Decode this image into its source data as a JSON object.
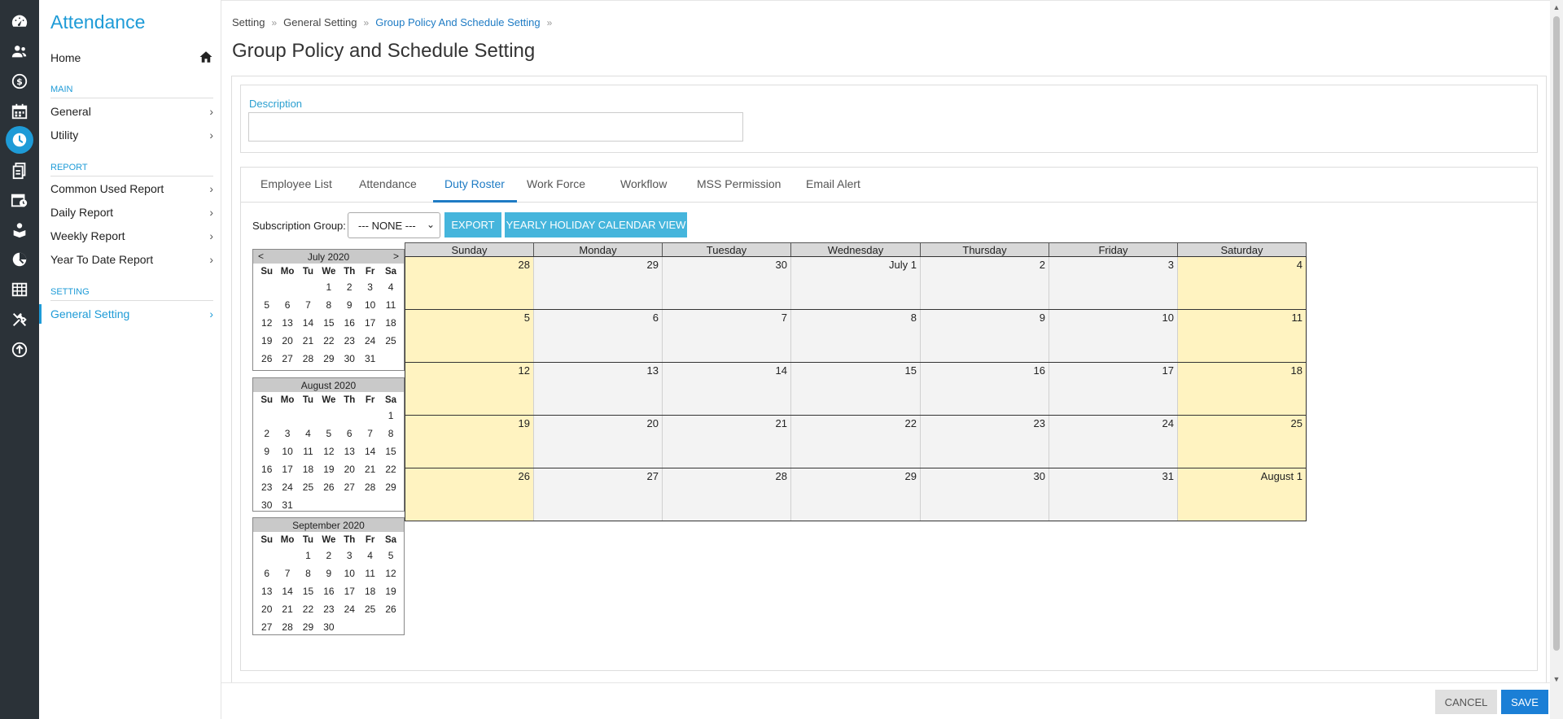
{
  "sidebar": {
    "app_title": "Attendance",
    "home_label": "Home",
    "sections": [
      {
        "title": "MAIN",
        "items": [
          "General",
          "Utility"
        ]
      },
      {
        "title": "REPORT",
        "items": [
          "Common Used Report",
          "Daily Report",
          "Weekly Report",
          "Year To Date Report"
        ]
      },
      {
        "title": "SETTING",
        "items": [
          "General Setting"
        ]
      }
    ],
    "active_item": "General Setting",
    "chevron": "›"
  },
  "breadcrumb": [
    "Setting",
    "General Setting",
    "Group Policy And Schedule Setting"
  ],
  "breadcrumb_sep": "»",
  "page_title": "Group Policy and Schedule Setting",
  "description": {
    "label": "Description",
    "value": ""
  },
  "tabs": [
    "Employee List",
    "Attendance",
    "Duty Roster",
    "Work Force",
    "Workflow",
    "MSS Permission",
    "Email Alert"
  ],
  "active_tab": "Duty Roster",
  "subscription": {
    "label": "Subscription Group:",
    "selected": "--- NONE ---"
  },
  "buttons": {
    "export": "EXPORT",
    "yearly": "YEARLY HOLIDAY CALENDAR VIEW",
    "cancel": "CANCEL",
    "save": "SAVE"
  },
  "mini_calendars": {
    "dow": [
      "Su",
      "Mo",
      "Tu",
      "We",
      "Th",
      "Fr",
      "Sa"
    ],
    "prev": "<",
    "next": ">",
    "months": [
      {
        "title": "July 2020",
        "weeks": [
          [
            "",
            "",
            "",
            "1",
            "2",
            "3",
            "4"
          ],
          [
            "5",
            "6",
            "7",
            "8",
            "9",
            "10",
            "11"
          ],
          [
            "12",
            "13",
            "14",
            "15",
            "16",
            "17",
            "18"
          ],
          [
            "19",
            "20",
            "21",
            "22",
            "23",
            "24",
            "25"
          ],
          [
            "26",
            "27",
            "28",
            "29",
            "30",
            "31",
            ""
          ]
        ]
      },
      {
        "title": "August 2020",
        "weeks": [
          [
            "",
            "",
            "",
            "",
            "",
            "",
            "1"
          ],
          [
            "2",
            "3",
            "4",
            "5",
            "6",
            "7",
            "8"
          ],
          [
            "9",
            "10",
            "11",
            "12",
            "13",
            "14",
            "15"
          ],
          [
            "16",
            "17",
            "18",
            "19",
            "20",
            "21",
            "22"
          ],
          [
            "23",
            "24",
            "25",
            "26",
            "27",
            "28",
            "29"
          ],
          [
            "30",
            "31",
            "",
            "",
            "",
            "",
            ""
          ]
        ]
      },
      {
        "title": "September 2020",
        "weeks": [
          [
            "",
            "",
            "1",
            "2",
            "3",
            "4",
            "5"
          ],
          [
            "6",
            "7",
            "8",
            "9",
            "10",
            "11",
            "12"
          ],
          [
            "13",
            "14",
            "15",
            "16",
            "17",
            "18",
            "19"
          ],
          [
            "20",
            "21",
            "22",
            "23",
            "24",
            "25",
            "26"
          ],
          [
            "27",
            "28",
            "29",
            "30",
            "",
            "",
            ""
          ]
        ]
      }
    ]
  },
  "calendar": {
    "days": [
      "Sunday",
      "Monday",
      "Tuesday",
      "Wednesday",
      "Thursday",
      "Friday",
      "Saturday"
    ],
    "weeks": [
      [
        "28",
        "29",
        "30",
        "July 1",
        "2",
        "3",
        "4"
      ],
      [
        "5",
        "6",
        "7",
        "8",
        "9",
        "10",
        "11"
      ],
      [
        "12",
        "13",
        "14",
        "15",
        "16",
        "17",
        "18"
      ],
      [
        "19",
        "20",
        "21",
        "22",
        "23",
        "24",
        "25"
      ],
      [
        "26",
        "27",
        "28",
        "29",
        "30",
        "31",
        "August 1"
      ]
    ]
  },
  "colors": {
    "accent": "#1e9bd7",
    "weekend": "#fff3c1",
    "weekday": "#f3f3f3",
    "save": "#1b7fd6"
  }
}
